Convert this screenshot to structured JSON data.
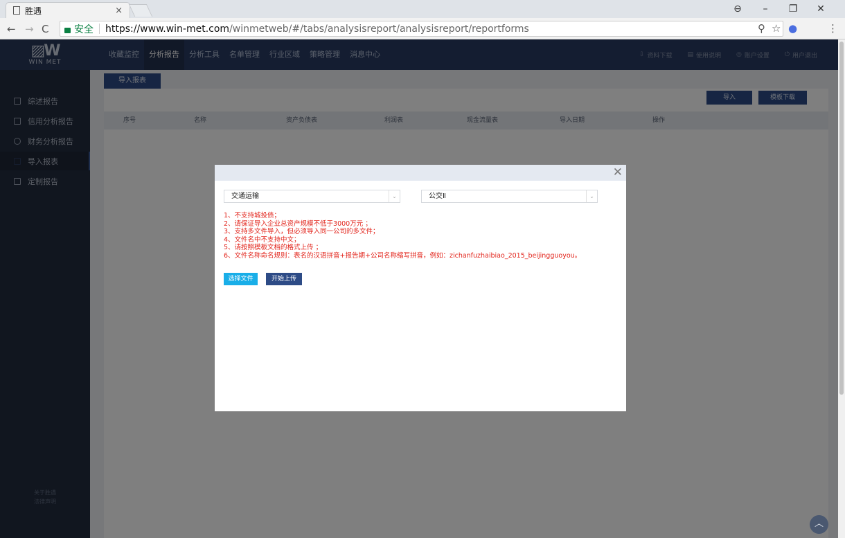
{
  "browser": {
    "tab_title": "胜遇",
    "tab_close": "×",
    "url_secure_label": "安全",
    "url_host": "https://www.win-met.com",
    "url_path": "/winmetweb/#/tabs/analysisreport/analysisreport/reportforms"
  },
  "app": {
    "logo_mark": "▨W",
    "logo_name": "WIN MET",
    "menu": [
      "收藏监控",
      "分析报告",
      "分析工具",
      "名单管理",
      "行业区域",
      "策略管理",
      "消息中心"
    ],
    "menu_active": 1,
    "top_right": [
      {
        "icon": "download-icon",
        "label": "资料下载"
      },
      {
        "icon": "document-icon",
        "label": "使用说明"
      },
      {
        "icon": "settings-icon",
        "label": "账户设置"
      },
      {
        "icon": "power-icon",
        "label": "用户退出"
      }
    ],
    "sidebar": [
      {
        "label": "综述报告",
        "icon": "report-icon"
      },
      {
        "label": "信用分析报告",
        "icon": "credit-icon"
      },
      {
        "label": "财务分析报告",
        "icon": "finance-icon"
      },
      {
        "label": "导入报表",
        "icon": "import-icon",
        "active": true
      },
      {
        "label": "定制报告",
        "icon": "custom-icon"
      }
    ],
    "sidebar_footer": [
      "关于胜遇",
      "法律声明"
    ],
    "page_tab": "导入报表",
    "buttons": {
      "import": "导入",
      "template_download": "模板下载"
    },
    "table_headers": [
      "序号",
      "名称",
      "资产负债表",
      "利润表",
      "现金流量表",
      "导入日期",
      "操作"
    ]
  },
  "modal": {
    "industry_select": "交通运输",
    "subindustry_select": "公交Ⅱ",
    "notes": [
      "1、不支持城投债；",
      "2、请保证导入企业总资产规模不低于3000万元 ；",
      "3、支持多文件导入，但必须导入同一公司的多文件；",
      "4、文件名中不支持中文；",
      "5、请按照模板文档的格式上传 ；",
      "6、文件名称命名规则：表名的汉语拼音+报告期+公司名称缩写拼音，例如：zichanfuzhaibiao_2015_beijingguoyou。"
    ],
    "choose_file": "选择文件",
    "start_upload": "开始上传"
  },
  "colors": {
    "nav_bg": "#283b63",
    "sidebar_bg": "#232d3f",
    "accent": "#2d4b86",
    "choose_btn": "#19aee8",
    "note_red": "#e2231a"
  }
}
